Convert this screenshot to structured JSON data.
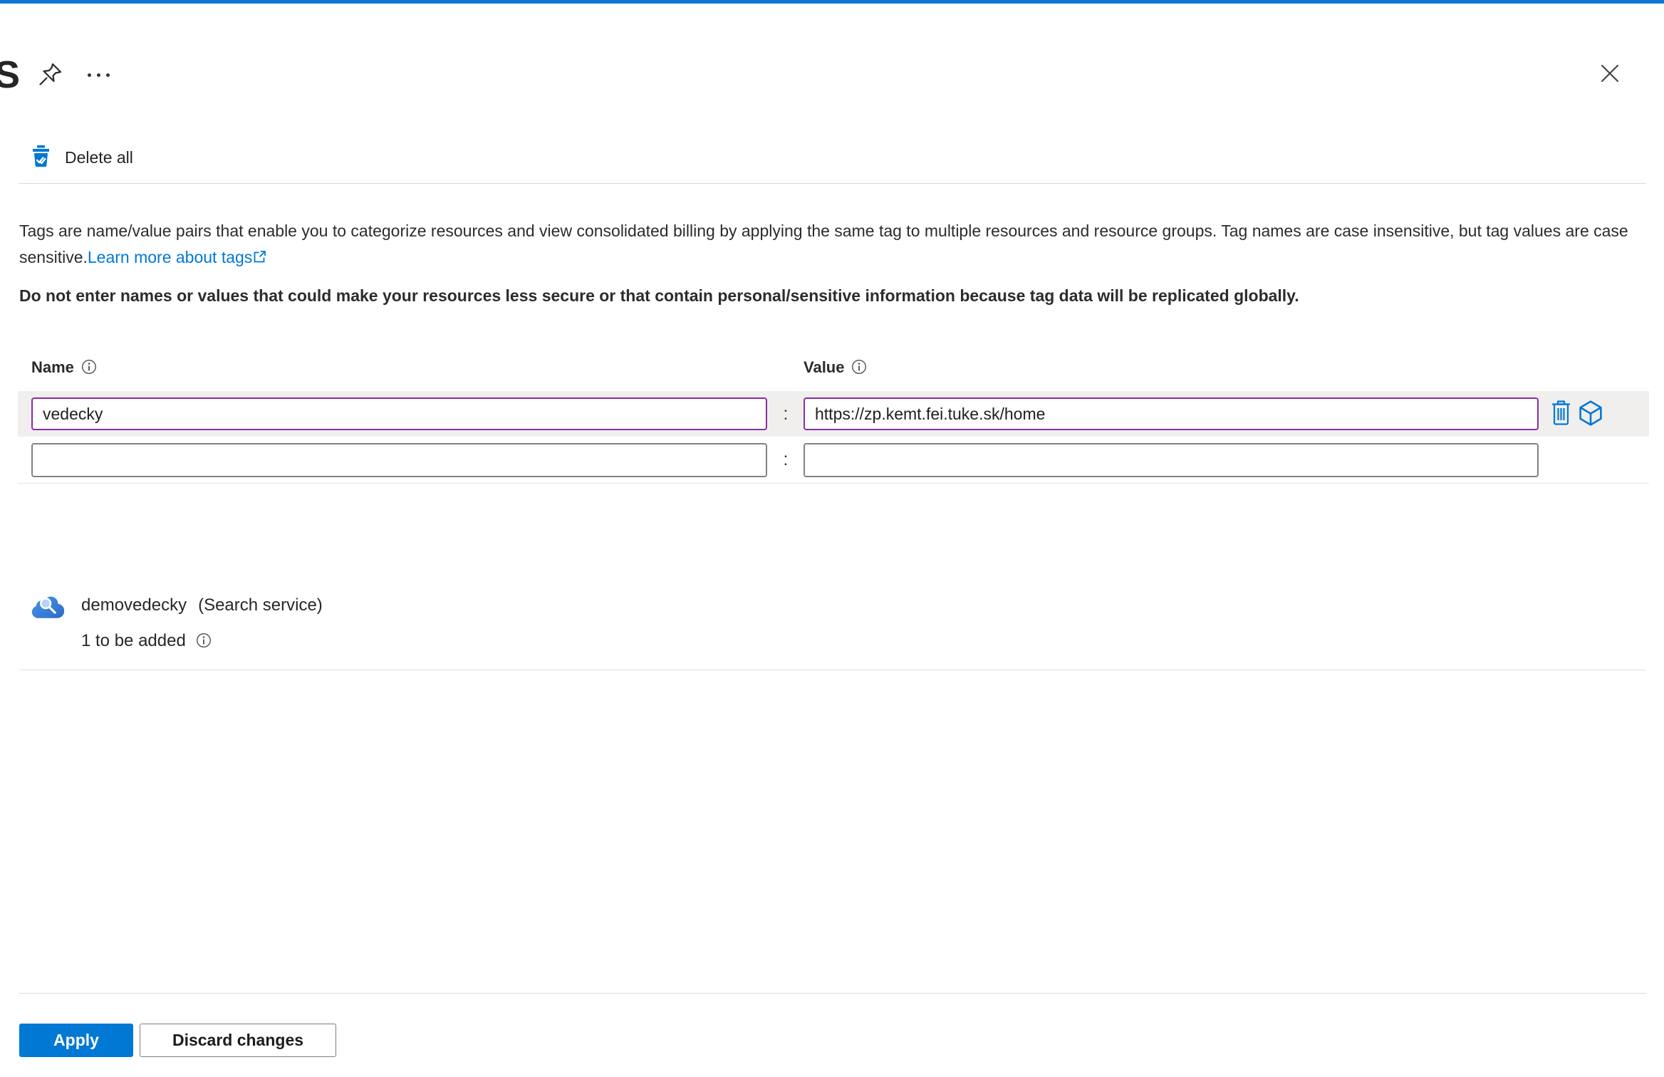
{
  "colors": {
    "accent": "#0078d4",
    "dirty_border": "#8a2da5",
    "topbar": "#0b79d4"
  },
  "header": {
    "title_fragment": "S"
  },
  "commandbar": {
    "delete_all": "Delete all"
  },
  "intro": {
    "body": "Tags are name/value pairs that enable you to categorize resources and view consolidated billing by applying the same tag to multiple resources and resource groups. Tag names are case insensitive, but tag values are case sensitive.",
    "link": "Learn more about tags",
    "warning": "Do not enter names or values that could make your resources less secure or that contain personal/sensitive information because tag data will be replicated globally."
  },
  "table": {
    "name_header": "Name",
    "value_header": "Value",
    "colon": ":",
    "rows": [
      {
        "name": "vedecky",
        "value": "https://zp.kemt.fei.tuke.sk/home"
      },
      {
        "name": "",
        "value": ""
      }
    ]
  },
  "resource": {
    "name": "demovedecky",
    "type": "(Search service)",
    "pending": "1 to be added"
  },
  "footer": {
    "apply": "Apply",
    "discard": "Discard changes"
  }
}
